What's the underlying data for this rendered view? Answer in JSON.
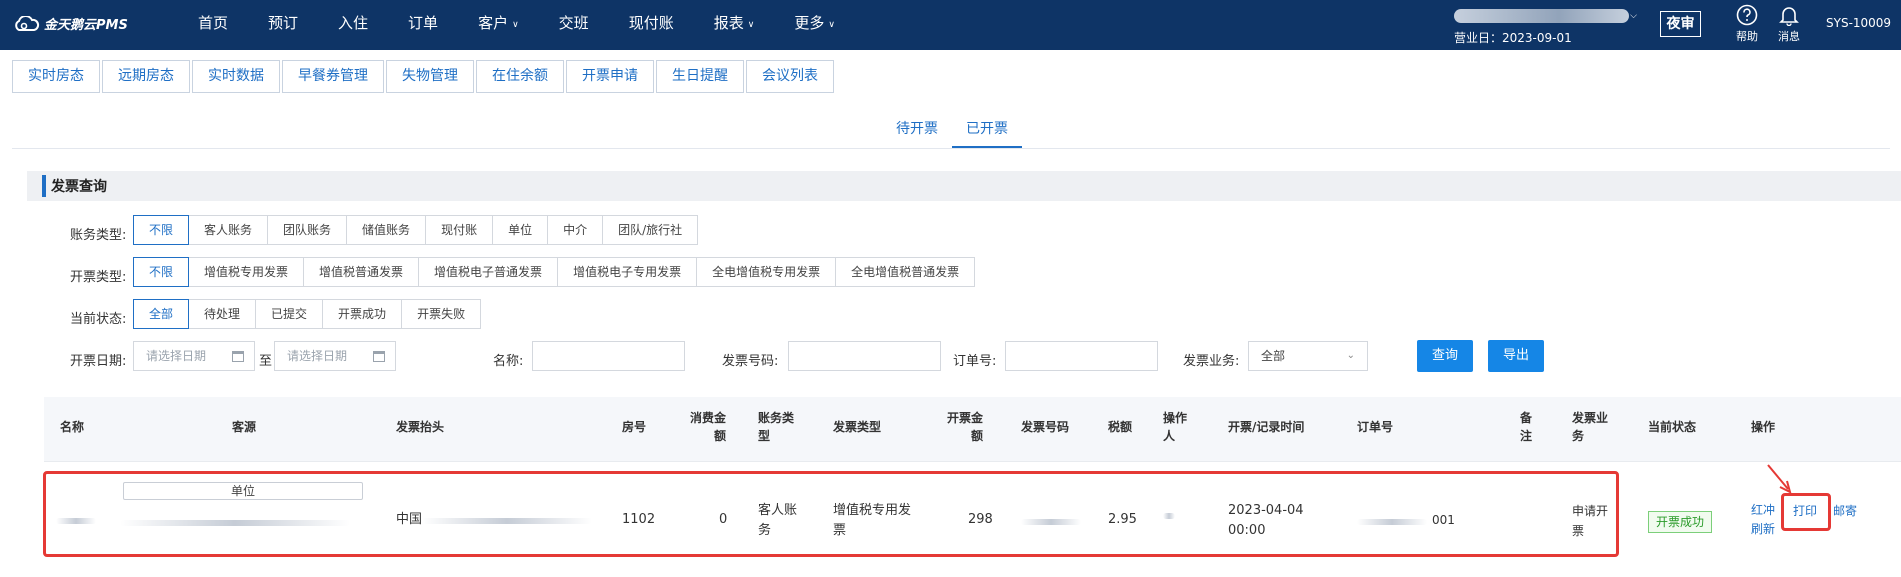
{
  "app": {
    "logo": "金天鹅云PMS"
  },
  "nav": [
    {
      "label": "首页",
      "dropdown": false
    },
    {
      "label": "预订",
      "dropdown": false
    },
    {
      "label": "入住",
      "dropdown": false
    },
    {
      "label": "订单",
      "dropdown": false
    },
    {
      "label": "客户",
      "dropdown": true
    },
    {
      "label": "交班",
      "dropdown": false
    },
    {
      "label": "现付账",
      "dropdown": false
    },
    {
      "label": "报表",
      "dropdown": true
    },
    {
      "label": "更多",
      "dropdown": true
    }
  ],
  "header": {
    "business_date": "营业日：2023-09-01",
    "night_audit": "夜审",
    "help": "帮助",
    "messages": "消息",
    "user": "SYS-10009"
  },
  "subtabs": [
    "实时房态",
    "远期房态",
    "实时数据",
    "早餐券管理",
    "失物管理",
    "在住余额",
    "开票申请",
    "生日提醒",
    "会议列表"
  ],
  "seg_tabs": [
    "待开票",
    "已开票"
  ],
  "panel_title": "发票查询",
  "filters": {
    "account_type": {
      "label": "账务类型:",
      "options": [
        "不限",
        "客人账务",
        "团队账务",
        "储值账务",
        "现付账",
        "单位",
        "中介",
        "团队/旅行社"
      ],
      "selected": 0
    },
    "invoice_type": {
      "label": "开票类型:",
      "options": [
        "不限",
        "增值税专用发票",
        "增值税普通发票",
        "增值税电子普通发票",
        "增值税电子专用发票",
        "全电增值税专用发票",
        "全电增值税普通发票"
      ],
      "selected": 0
    },
    "status": {
      "label": "当前状态:",
      "options": [
        "全部",
        "待处理",
        "已提交",
        "开票成功",
        "开票失败"
      ],
      "selected": 0
    },
    "date_label": "开票日期:",
    "date_placeholder": "请选择日期",
    "date_to": "至",
    "name_label": "名称:",
    "invoice_no_label": "发票号码:",
    "order_no_label": "订单号:",
    "business_label": "发票业务:",
    "business_value": "全部",
    "query_btn": "查询",
    "export_btn": "导出"
  },
  "table": {
    "headers": {
      "name": "名称",
      "source": "客源",
      "title": "发票抬头",
      "room": "房号",
      "amount1": "消费金",
      "amount2": "额",
      "acct1": "账务类",
      "acct2": "型",
      "type": "发票类型",
      "inv1": "开票金",
      "inv2": "额",
      "number": "发票号码",
      "tax": "税额",
      "op1": "操作",
      "op2": "人",
      "time": "开票/记录时间",
      "order": "订单号",
      "remark1": "备",
      "remark2": "注",
      "biz1": "发票业",
      "biz2": "务",
      "status": "当前状态",
      "action": "操作"
    },
    "row": {
      "source_tag": "单位",
      "title_prefix": "中国",
      "room": "1102",
      "consume": "0",
      "acct1": "客人账",
      "acct2": "务",
      "type1": "增值税专用发",
      "type2": "票",
      "invoice_amount": "298",
      "tax": "2.95",
      "time1": "2023-04-04",
      "time2": "00:00",
      "order_suffix": "001",
      "biz1": "申请开",
      "biz2": "票",
      "status": "开票成功",
      "actions": {
        "red": "红冲",
        "refresh": "刷新",
        "print": "打印",
        "mail": "邮寄"
      }
    }
  },
  "colors": {
    "nav_bg": "#0e3466",
    "accent": "#1f6fc5",
    "primary": "#1586e6",
    "highlight": "#e53935",
    "success": "#2a9b2a"
  }
}
